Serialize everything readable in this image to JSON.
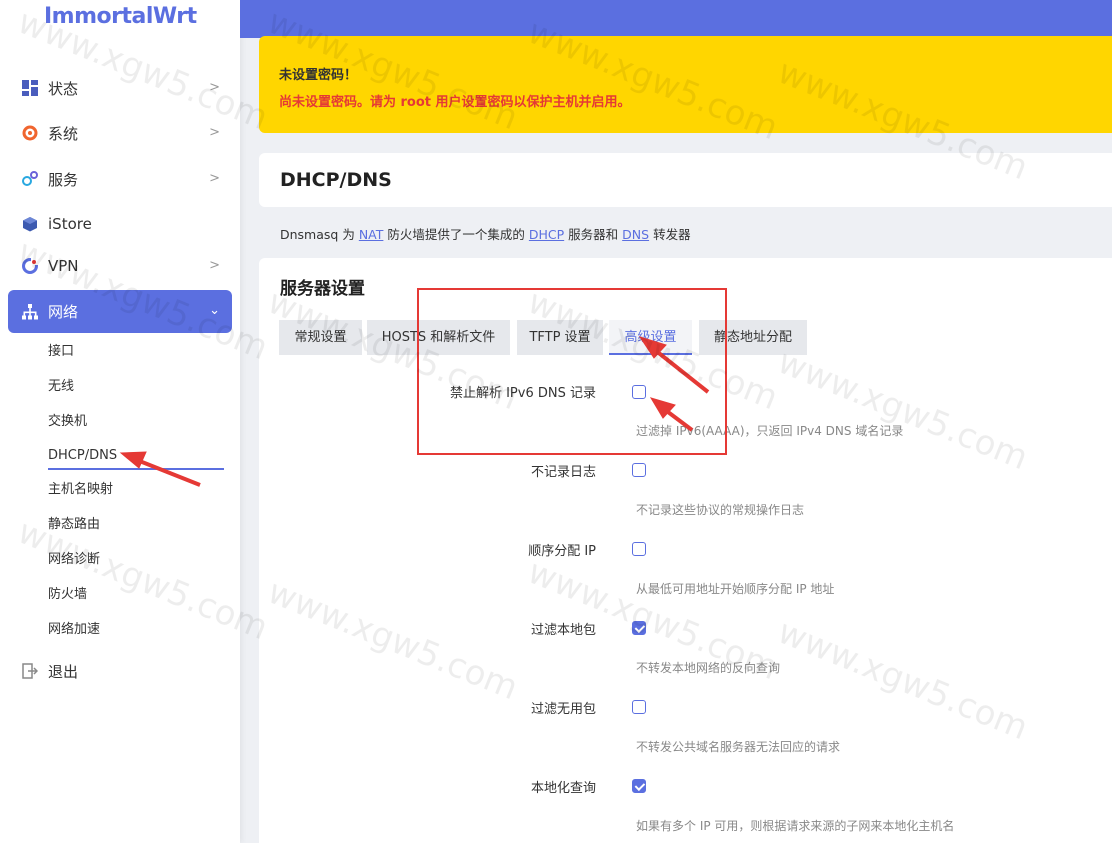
{
  "brand": {
    "logo": "ImmortalWrt"
  },
  "sidebar": {
    "items": [
      {
        "label": "状态",
        "icon": "dashboard-icon"
      },
      {
        "label": "系统",
        "icon": "gear-icon"
      },
      {
        "label": "服务",
        "icon": "services-icon"
      },
      {
        "label": "iStore",
        "icon": "box-icon"
      },
      {
        "label": "VPN",
        "icon": "vpn-icon"
      },
      {
        "label": "网络",
        "icon": "network-icon"
      }
    ],
    "network_sub": [
      "接口",
      "无线",
      "交换机",
      "DHCP/DNS",
      "主机名映射",
      "静态路由",
      "网络诊断",
      "防火墙",
      "网络加速"
    ],
    "logout": "退出"
  },
  "alert": {
    "title": "未设置密码！",
    "message": "尚未设置密码。请为 root 用户设置密码以保护主机并启用。"
  },
  "page": {
    "title": "DHCP/DNS",
    "desc_prefix": "Dnsmasq 为",
    "desc_nat": "NAT",
    "desc_mid1": "防火墙提供了一个集成的",
    "desc_dhcp": "DHCP",
    "desc_mid2": "服务器和",
    "desc_dns": "DNS",
    "desc_suffix": "转发器"
  },
  "section": {
    "title": "服务器设置",
    "tabs": [
      "常规设置",
      "HOSTS 和解析文件",
      "TFTP 设置",
      "高级设置",
      "静态地址分配"
    ],
    "active_tab": "高级设置"
  },
  "options": [
    {
      "label": "禁止解析 IPv6 DNS 记录",
      "checked": false,
      "desc": "过滤掉 IPv6(AAAA)，只返回 IPv4 DNS 域名记录"
    },
    {
      "label": "不记录日志",
      "checked": false,
      "desc": "不记录这些协议的常规操作日志"
    },
    {
      "label": "顺序分配 IP",
      "checked": false,
      "desc": "从最低可用地址开始顺序分配 IP 地址"
    },
    {
      "label": "过滤本地包",
      "checked": true,
      "desc": "不转发本地网络的反向查询"
    },
    {
      "label": "过滤无用包",
      "checked": false,
      "desc": "不转发公共域名服务器无法回应的请求"
    },
    {
      "label": "本地化查询",
      "checked": true,
      "desc": "如果有多个 IP 可用，则根据请求来源的子网来本地化主机名"
    }
  ],
  "watermark": "www.xgw5.com",
  "colors": {
    "accent": "#5b6fe0",
    "alert_bg": "#ffd600",
    "alert_text": "#e53935",
    "annotation": "#e53935"
  }
}
